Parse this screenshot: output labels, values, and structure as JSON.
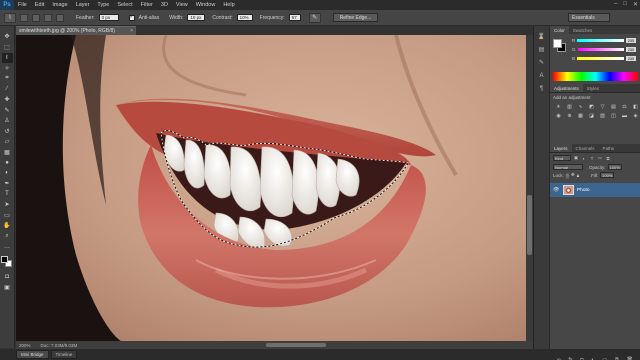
{
  "menu": [
    "File",
    "Edit",
    "Image",
    "Layer",
    "Type",
    "Select",
    "Filter",
    "3D",
    "View",
    "Window",
    "Help"
  ],
  "app_logo": "Ps",
  "window_controls": [
    "–",
    "□",
    "✕"
  ],
  "options": {
    "feather_label": "Feather:",
    "feather_value": "0 px",
    "antialias_label": "Anti-alias",
    "width_label": "Width:",
    "width_value": "10 px",
    "contrast_label": "Contrast:",
    "contrast_value": "10%",
    "frequency_label": "Frequency:",
    "frequency_value": "57",
    "refine_label": "Refine Edge...",
    "workspace": "Essentials"
  },
  "document": {
    "tab_title": "smilewithteeth.jpg @ 200% (Photo, RGB/8)",
    "zoom": "200%",
    "doc_info": "Doc: 7.03M/9.03M"
  },
  "bottom_tabs": [
    "Mini Bridge",
    "Timeline"
  ],
  "panels": {
    "color_tabs": [
      "Color",
      "Swatches"
    ],
    "color_sliders": [
      {
        "label": "R",
        "value": "255"
      },
      {
        "label": "G",
        "value": "255"
      },
      {
        "label": "B",
        "value": "255"
      }
    ],
    "adjust_tabs": [
      "Adjustments",
      "Styles"
    ],
    "adjust_title": "Add an adjustment",
    "layers_tabs": [
      "Layers",
      "Channels",
      "Paths"
    ],
    "kind_label": "Kind",
    "blend_mode": "Normal",
    "opacity_label": "Opacity:",
    "opacity_value": "100%",
    "lock_label": "Lock:",
    "fill_label": "Fill:",
    "fill_value": "100%",
    "layer_name": "Photo"
  }
}
